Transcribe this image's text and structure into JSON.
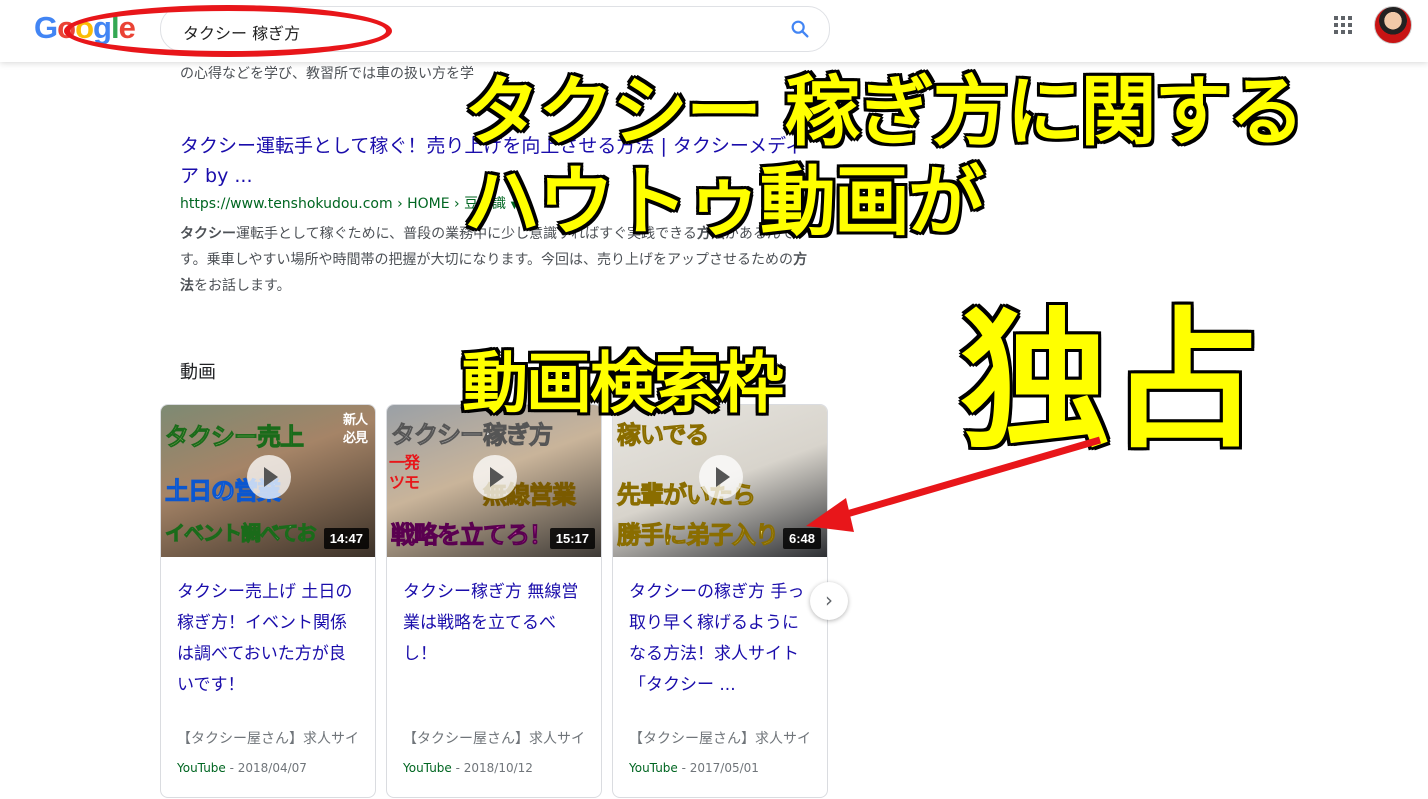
{
  "header": {
    "logo": [
      "G",
      "o",
      "o",
      "g",
      "l",
      "e"
    ],
    "search_query": "タクシー 稼ぎ方"
  },
  "results": {
    "snippet_fragment": "の心得などを学び、教習所では車の扱い方を学",
    "result": {
      "title": "タクシー運転手として稼ぐ！売り上げを向上させる方法 | タクシーメディア by ...",
      "url": "https://www.tenshokudou.com › HOME › 豆知識",
      "desc_bold_1": "タクシー",
      "desc_1": "運転手として稼ぐために、普段の業務中に少し意識すればすぐ実践できる",
      "desc_bold_2": "方法",
      "desc_2": "があるんです。乗車しやすい場所や時間帯の把握が大切になります。今回は、売り上げをアップさせるための",
      "desc_bold_3": "方法",
      "desc_3": "をお話します。"
    }
  },
  "videos": {
    "heading": "動画",
    "cards": [
      {
        "thumb_texts": [
          "タクシー売上",
          "新人",
          "必見",
          "土日の営業",
          "イベント調べてお"
        ],
        "duration": "14:47",
        "title": "タクシー売上げ 土日の稼ぎ方！イベント関係は調べておいた方が良いです！",
        "channel": "【タクシー屋さん】求人サイ",
        "source": "YouTube",
        "date": " - 2018/04/07"
      },
      {
        "thumb_texts": [
          "タクシー稼ぎ方",
          "一発",
          "ツモ",
          "無線営業",
          "戦略を立てろ！"
        ],
        "duration": "15:17",
        "title": "タクシー稼ぎ方 無線営業は戦略を立てるべし！",
        "channel": "【タクシー屋さん】求人サイ",
        "source": "YouTube",
        "date": " - 2018/10/12"
      },
      {
        "thumb_texts": [
          "稼いでる",
          "先輩がいたら",
          "勝手に弟子入り"
        ],
        "duration": "6:48",
        "title": "タクシーの稼ぎ方 手っ取り早く稼げるようになる方法！求人サイト「タクシー ...",
        "channel": "【タクシー屋さん】求人サイ",
        "source": "YouTube",
        "date": " - 2017/05/01"
      }
    ],
    "next_label": "›"
  },
  "overlay": {
    "line1": "タクシー 稼ぎ方に関する",
    "line2": "ハウトゥ動画が",
    "line3": "動画検索枠",
    "line4": "独占"
  },
  "colors": {
    "overlay_text": "#ffff00",
    "annotation_red": "#e8161a",
    "link_blue": "#1a0dab",
    "url_green": "#006621"
  }
}
